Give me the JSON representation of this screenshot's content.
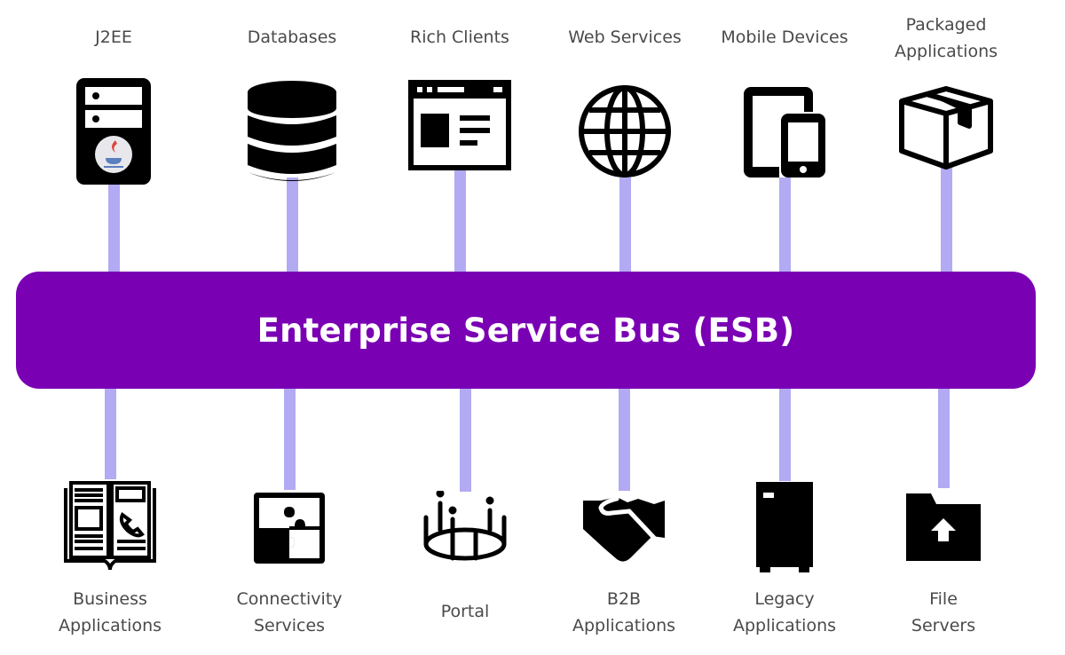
{
  "bus": {
    "title": "Enterprise Service Bus (ESB)",
    "color": "#7a00b4",
    "connector_color": "#b2aaf2"
  },
  "top_nodes": [
    {
      "label": "J2EE",
      "icon": "java-server-icon"
    },
    {
      "label": "Databases",
      "icon": "database-icon"
    },
    {
      "label": "Rich Clients",
      "icon": "browser-window-icon"
    },
    {
      "label": "Web Services",
      "icon": "globe-icon"
    },
    {
      "label": "Mobile Devices",
      "icon": "tablet-phone-icon"
    },
    {
      "label": "Packaged\nApplications",
      "label_lines": [
        "Packaged",
        "Applications"
      ],
      "icon": "package-box-icon"
    }
  ],
  "bottom_nodes": [
    {
      "label_lines": [
        "Business",
        "Applications"
      ],
      "icon": "book-phone-icon"
    },
    {
      "label_lines": [
        "Connectivity",
        "Services"
      ],
      "icon": "puzzle-icon"
    },
    {
      "label_lines": [
        "Portal"
      ],
      "icon": "portal-icon"
    },
    {
      "label_lines": [
        "B2B",
        "Applications"
      ],
      "icon": "handshake-icon"
    },
    {
      "label_lines": [
        "Legacy",
        "Applications"
      ],
      "icon": "legacy-server-icon"
    },
    {
      "label_lines": [
        "File",
        "Servers"
      ],
      "icon": "folder-upload-icon"
    }
  ]
}
